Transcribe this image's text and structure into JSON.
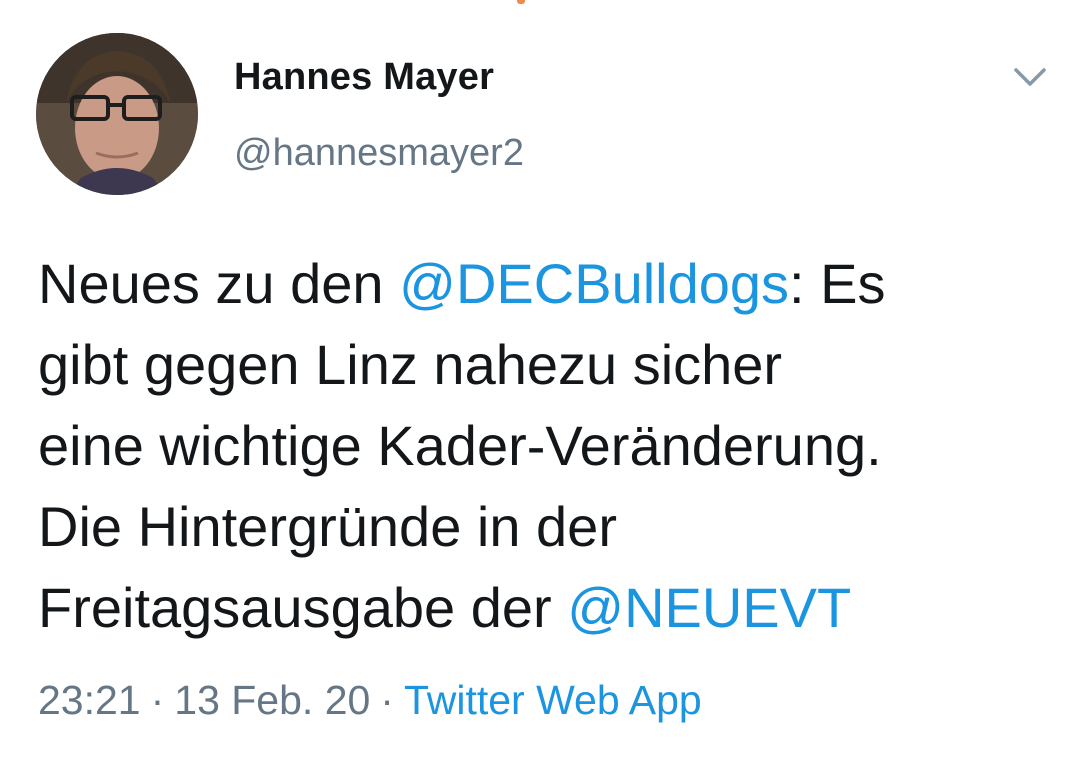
{
  "author": {
    "name": "Hannes Mayer",
    "handle": "@hannesmayer2"
  },
  "tweet": {
    "line1_pre": "Neues zu den ",
    "mention1": "@DECBulldogs",
    "line1_post": ": Es",
    "line2": "gibt gegen Linz nahezu sicher",
    "line3": "eine wichtige Kader-Veränderung.",
    "line4": "Die Hintergründe in der",
    "line5_pre": "Freitagsausgabe der ",
    "mention2": "@NEUEVT"
  },
  "meta": {
    "time": "23:21",
    "date": "13 Feb. 20",
    "separator": "·",
    "source": "Twitter Web App"
  },
  "colors": {
    "link": "#1b95e0",
    "text": "#14171a",
    "secondary": "#657786"
  },
  "icons": {
    "menu": "chevron-down-icon",
    "avatar": "avatar"
  }
}
